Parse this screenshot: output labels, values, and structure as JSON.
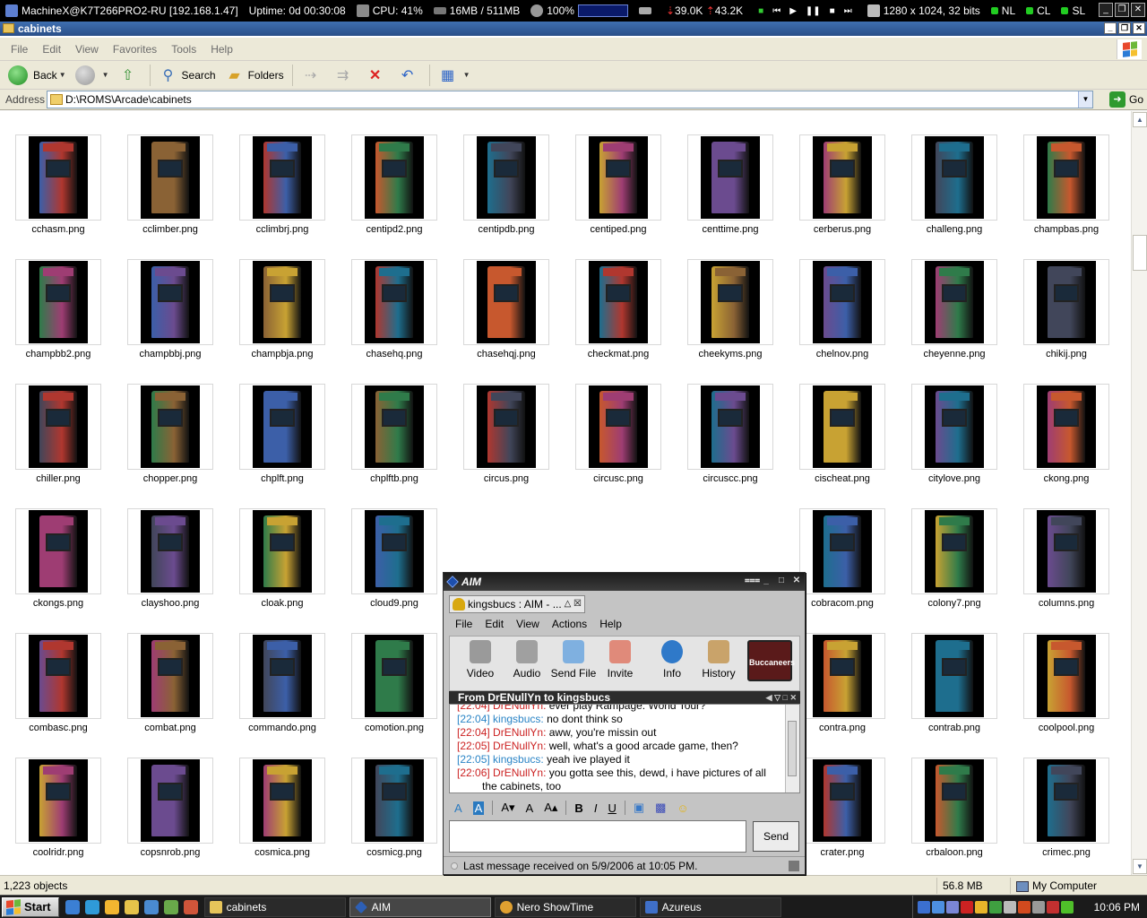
{
  "sysbar": {
    "machine": "MachineX@K7T266PRO2-RU [192.168.1.47]",
    "uptime": "Uptime: 0d 00:30:08",
    "cpu": "CPU: 41%",
    "memory": "16MB / 511MB",
    "volume": "100%",
    "net_down": "39.0K",
    "net_up": "43.2K",
    "resolution": "1280 x 1024, 32 bits",
    "lang1": "NL",
    "lang2": "CL",
    "lang3": "SL"
  },
  "explorer": {
    "title": "cabinets",
    "menu": [
      "File",
      "Edit",
      "View",
      "Favorites",
      "Tools",
      "Help"
    ],
    "toolbar": {
      "back": "Back",
      "search": "Search",
      "folders": "Folders"
    },
    "address_label": "Address",
    "address": "D:\\ROMS\\Arcade\\cabinets",
    "go": "Go",
    "files": [
      [
        "cchasm.png",
        "cclimber.png",
        "cclimbrj.png",
        "centipd2.png",
        "centipdb.png",
        "centiped.png",
        "centtime.png",
        "cerberus.png",
        "challeng.png",
        "champbas.png"
      ],
      [
        "champbb2.png",
        "champbbj.png",
        "champbja.png",
        "chasehq.png",
        "chasehqj.png",
        "checkmat.png",
        "cheekyms.png",
        "chelnov.png",
        "cheyenne.png",
        "chikij.png"
      ],
      [
        "chiller.png",
        "chopper.png",
        "chplft.png",
        "chplftb.png",
        "circus.png",
        "circusc.png",
        "circuscc.png",
        "cischeat.png",
        "citylove.png",
        "ckong.png"
      ],
      [
        "ckongs.png",
        "clayshoo.png",
        "cloak.png",
        "cloud9.png",
        "",
        "",
        "",
        "cobracom.png",
        "colony7.png",
        "columns.png"
      ],
      [
        "combasc.png",
        "combat.png",
        "commando.png",
        "comotion.png",
        "",
        "",
        "",
        "contra.png",
        "contrab.png",
        "coolpool.png"
      ],
      [
        "coolridr.png",
        "copsnrob.png",
        "cosmica.png",
        "cosmicg.png",
        "",
        "",
        "",
        "crater.png",
        "crbaloon.png",
        "crimec.png"
      ]
    ],
    "status": {
      "objects": "1,223 objects",
      "size": "56.8 MB",
      "location": "My Computer"
    }
  },
  "aim": {
    "title": "AIM",
    "tab": "kingsbucs : AIM - ...",
    "menu": [
      "File",
      "Edit",
      "View",
      "Actions",
      "Help"
    ],
    "tools": [
      "Video",
      "Audio",
      "Send File",
      "Invite",
      "Info",
      "History"
    ],
    "buddy_icon": "Buccaneers",
    "conversation_header": "From DrENullYn to kingsbucs",
    "messages": [
      {
        "time": "[22:04]",
        "from": "DrENullYn",
        "text": "ever play Rampage: World Tour?",
        "who": "other"
      },
      {
        "time": "[22:04]",
        "from": "kingsbucs",
        "text": "no dont think so",
        "who": "me"
      },
      {
        "time": "[22:04]",
        "from": "DrENullYn",
        "text": "aww, you're missin out",
        "who": "other"
      },
      {
        "time": "[22:05]",
        "from": "DrENullYn",
        "text": "well, what's a good arcade game, then?",
        "who": "other"
      },
      {
        "time": "[22:05]",
        "from": "kingsbucs",
        "text": "yeah ive played it",
        "who": "me"
      },
      {
        "time": "[22:06]",
        "from": "DrENullYn",
        "text": "you gotta see this, dewd, i have pictures of all the cabinets, too",
        "who": "other"
      }
    ],
    "send": "Send",
    "status": "Last message received on 5/9/2006 at 10:05 PM."
  },
  "taskbar": {
    "start": "Start",
    "tasks": [
      "cabinets",
      "AIM",
      "Nero ShowTime",
      "Azureus"
    ],
    "clock": "10:06 PM"
  },
  "colors": {
    "other_user": "#cc2222",
    "self_user": "#2a84c6",
    "cabinet_palette": [
      "#3c5fa8",
      "#c7582e",
      "#6b4b8f",
      "#2f7b4a",
      "#b0372f",
      "#c8a233",
      "#41465a",
      "#8a6235",
      "#1e6e8e",
      "#9e3d73"
    ]
  }
}
